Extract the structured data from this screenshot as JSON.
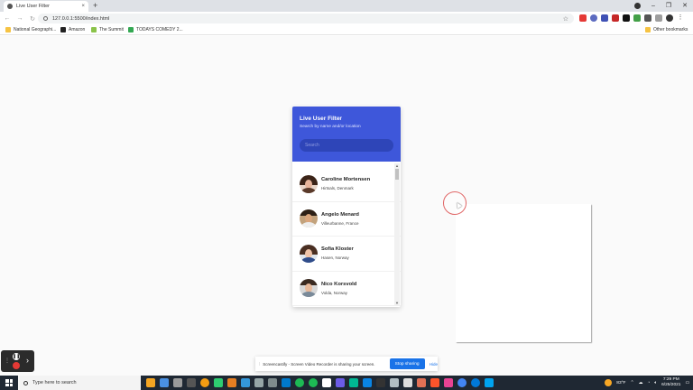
{
  "browser": {
    "tab_title": "Live User Filter",
    "tab_close": "×",
    "new_tab": "+",
    "url": "127.0.0.1:5500/index.html",
    "bookmarks": [
      "National Geographi...",
      "Amazon",
      "The Summit",
      "TODAYS COMEDY 2..."
    ],
    "other_bookmarks": "Other bookmarks"
  },
  "app": {
    "title": "Live User Filter",
    "subtitle": "Search by name and/or location",
    "search_placeholder": "Search",
    "users": [
      {
        "name": "Caroline Mortensen",
        "location": "Hirtsals, Denmark"
      },
      {
        "name": "Angelo Menard",
        "location": "Villeurbanne, France"
      },
      {
        "name": "Sofia Kloster",
        "location": "Hasen, Norway"
      },
      {
        "name": "Nico Korsvold",
        "location": "Volda, Norway"
      }
    ]
  },
  "screencastify": {
    "message": "Screencastify - Screen Video Recorder is sharing your screen.",
    "stop_label": "Stop sharing",
    "hide_label": "Hide"
  },
  "taskbar": {
    "search_placeholder": "Type here to search",
    "weather": "83°F",
    "time": "7:29 PM",
    "date": "6/25/2021"
  },
  "colors": {
    "header_blue": "#3e57da",
    "search_bg": "#2e45b8",
    "stop_button": "#1a73e8",
    "taskbar": "#1f2833"
  }
}
